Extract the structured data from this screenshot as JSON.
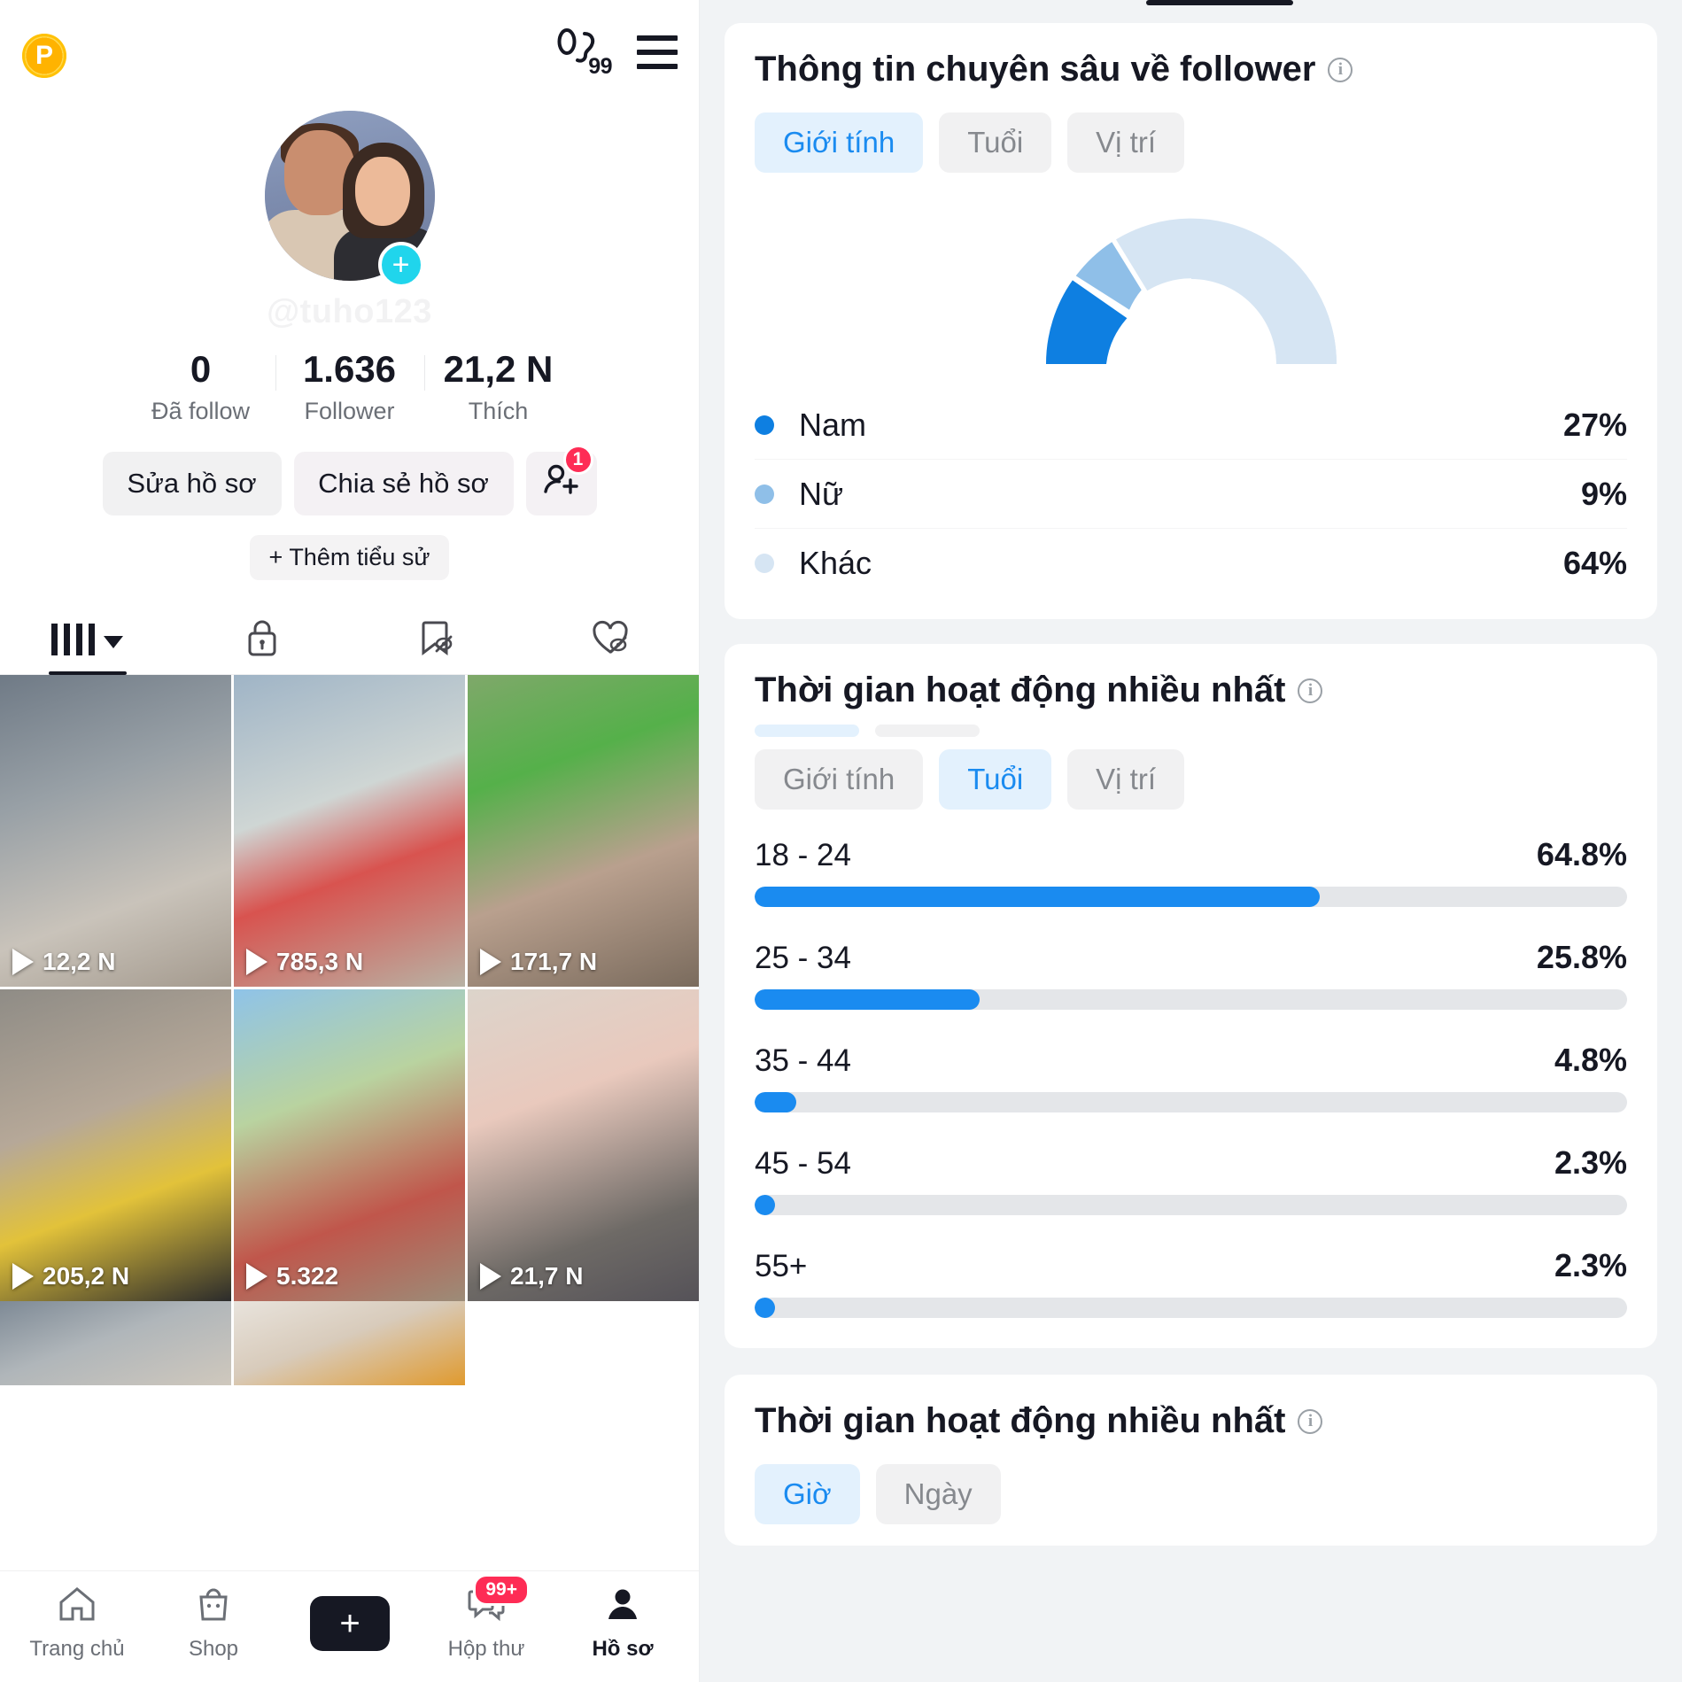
{
  "profile": {
    "pro_badge": "P",
    "footprint_count": "99",
    "footprint_icon": "footprint-icon",
    "menu_icon": "hamburger-menu-icon",
    "handle": "@tuho123",
    "avatar_plus": "+",
    "stats": [
      {
        "value": "0",
        "label": "Đã follow"
      },
      {
        "value": "1.636",
        "label": "Follower"
      },
      {
        "value": "21,2 N",
        "label": "Thích"
      }
    ],
    "buttons": {
      "edit": "Sửa hồ sơ",
      "share": "Chia sẻ hồ sơ",
      "find_friends_icon": "add-friend-icon",
      "find_friends_badge": "1"
    },
    "add_bio": "+ Thêm tiểu sử",
    "tabs": [
      {
        "icon": "grid-icon",
        "active": true
      },
      {
        "icon": "lock-icon",
        "active": false
      },
      {
        "icon": "bookmark-hidden-icon",
        "active": false
      },
      {
        "icon": "heart-hidden-icon",
        "active": false
      }
    ],
    "videos": [
      {
        "views": "12,2 N",
        "thumb": "t1"
      },
      {
        "views": "785,3 N",
        "thumb": "t2"
      },
      {
        "views": "171,7 N",
        "thumb": "t3"
      },
      {
        "views": "205,2 N",
        "thumb": "t4"
      },
      {
        "views": "5.322",
        "thumb": "t5"
      },
      {
        "views": "21,7 N",
        "thumb": "t6"
      }
    ],
    "partial_thumbs": [
      "t7",
      "t8",
      "t9"
    ],
    "bottom_nav": [
      {
        "label": "Trang chủ",
        "icon": "home-icon",
        "active": false,
        "badge": ""
      },
      {
        "label": "Shop",
        "icon": "shop-bag-icon",
        "active": false,
        "badge": ""
      },
      {
        "label": "",
        "icon": "create-plus-icon",
        "active": false,
        "badge": ""
      },
      {
        "label": "Hộp thư",
        "icon": "inbox-message-icon",
        "active": false,
        "badge": "99+"
      },
      {
        "label": "Hồ sơ",
        "icon": "person-icon",
        "active": true,
        "badge": ""
      }
    ]
  },
  "analytics": {
    "follower_insights": {
      "title": "Thông tin chuyên sâu về follower",
      "info_icon": "info-icon",
      "segments": [
        {
          "label": "Giới tính",
          "active": true
        },
        {
          "label": "Tuổi",
          "active": false
        },
        {
          "label": "Vị trí",
          "active": false
        }
      ]
    },
    "most_active_age": {
      "title": "Thời gian hoạt động nhiều nhất",
      "info_icon": "info-icon",
      "segments": [
        {
          "label": "Giới tính",
          "active": false
        },
        {
          "label": "Tuổi",
          "active": true
        },
        {
          "label": "Vị trí",
          "active": false
        }
      ]
    },
    "most_active_time": {
      "title": "Thời gian hoạt động nhiều nhất",
      "info_icon": "info-icon",
      "segments": [
        {
          "label": "Giờ",
          "active": true
        },
        {
          "label": "Ngày",
          "active": false
        }
      ]
    },
    "colors": {
      "accent": "#1a8bf0",
      "gender_nam": "#0e7fe1",
      "gender_nu": "#8fbfe8",
      "gender_khac": "#d6e5f3",
      "track": "#e4e6e9",
      "badge_red": "#fe2c55"
    }
  },
  "chart_data": [
    {
      "type": "pie",
      "title": "Thông tin chuyên sâu về follower",
      "subtitle": "Giới tính",
      "legend_position": "bottom",
      "labels": [
        "Nam",
        "Nữ",
        "Khác"
      ],
      "values": [
        27,
        9,
        64
      ],
      "value_labels": [
        "27%",
        "9%",
        "64%"
      ],
      "colors": [
        "#0e7fe1",
        "#8fbfe8",
        "#d6e5f3"
      ],
      "note": "half-donut gauge, semicircle 180 degrees"
    },
    {
      "type": "bar",
      "title": "Thời gian hoạt động nhiều nhất",
      "subtitle": "Tuổi",
      "orientation": "horizontal",
      "categories": [
        "18 - 24",
        "25 - 34",
        "35 - 44",
        "45 - 54",
        "55+"
      ],
      "values": [
        64.8,
        25.8,
        4.8,
        2.3,
        2.3
      ],
      "value_labels": [
        "64.8%",
        "25.8%",
        "4.8%",
        "2.3%",
        "2.3%"
      ],
      "xlabel": "",
      "ylabel": "",
      "xlim": [
        0,
        100
      ],
      "grid": false,
      "color": "#1a8bf0"
    }
  ]
}
